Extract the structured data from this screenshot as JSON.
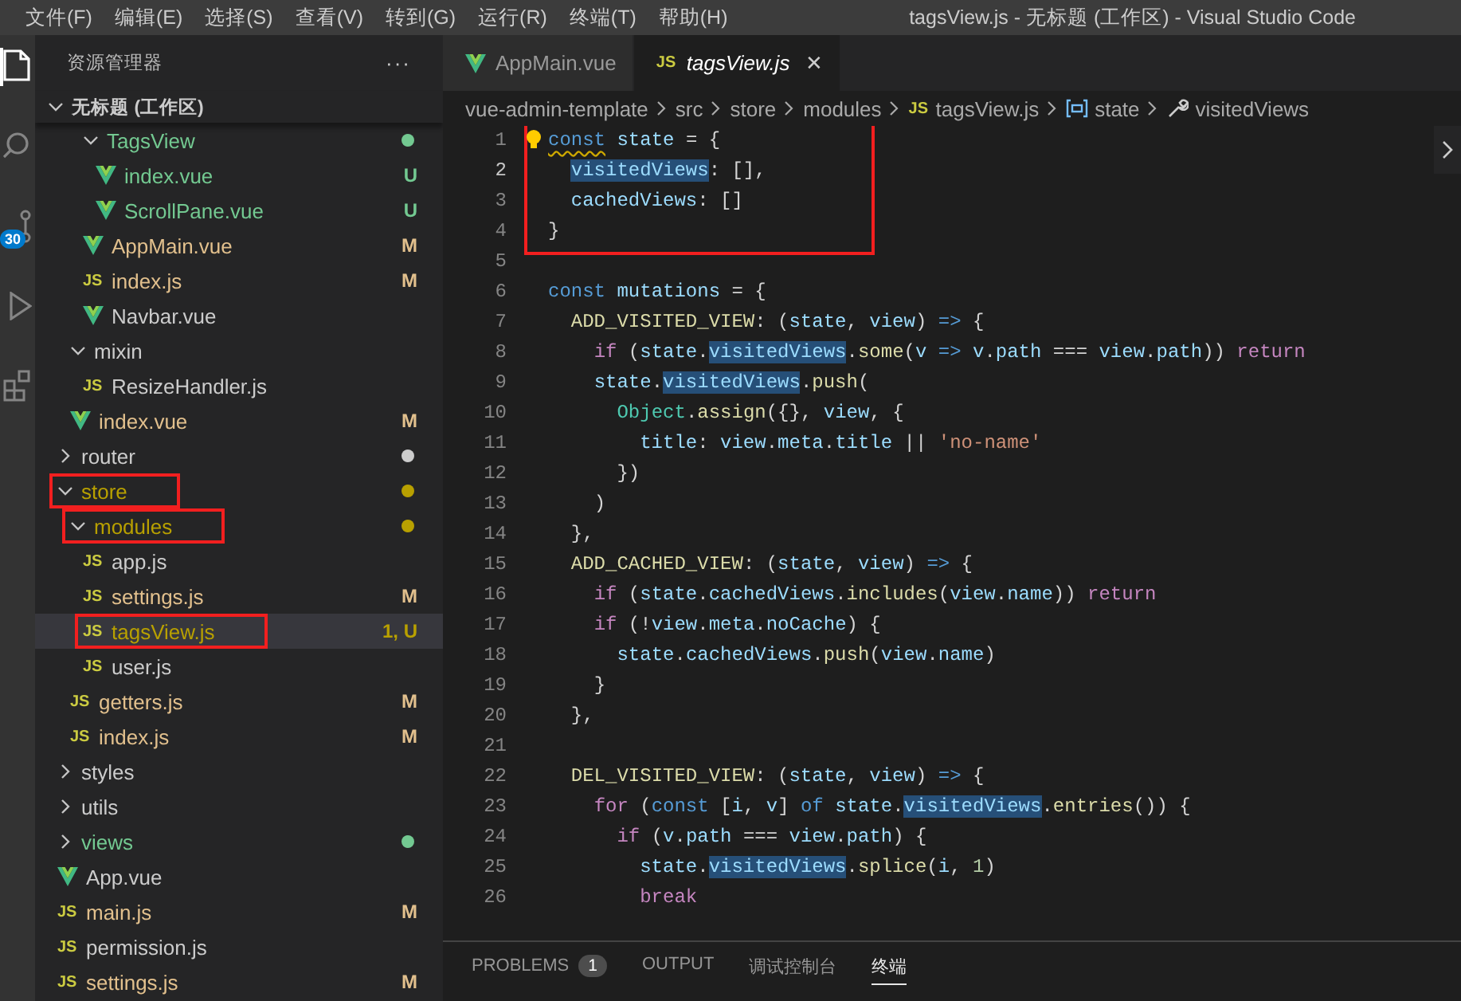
{
  "window": {
    "title": "tagsView.js - 无标题 (工作区) - Visual Studio Code"
  },
  "menu": [
    "文件(F)",
    "编辑(E)",
    "选择(S)",
    "查看(V)",
    "转到(G)",
    "运行(R)",
    "终端(T)",
    "帮助(H)"
  ],
  "activity_bar": [
    {
      "kind": "files",
      "selected": true
    },
    {
      "kind": "search",
      "selected": false
    },
    {
      "kind": "source-control",
      "selected": false,
      "badge": "30"
    },
    {
      "kind": "run",
      "selected": false
    },
    {
      "kind": "extensions",
      "selected": false
    }
  ],
  "sidebar": {
    "title": "资源管理器",
    "more": "···",
    "workspace": {
      "label": "无标题 (工作区)",
      "expanded": true
    },
    "items": [
      {
        "children": [
          {
            "children": [
              {
                "label": "TagsView",
                "kind": "folder",
                "expanded": true,
                "selected": false,
                "color": "#73c991",
                "dot": true,
                "children": [
                  {
                    "label": "index.vue",
                    "kind": "vue",
                    "selected": false,
                    "color": "#73c991",
                    "badge": "U"
                  },
                  {
                    "label": "ScrollPane.vue",
                    "kind": "vue",
                    "selected": false,
                    "color": "#73c991",
                    "badge": "U"
                  }
                ]
              },
              {
                "label": "AppMain.vue",
                "kind": "vue",
                "selected": false,
                "color": "#e2c08d",
                "badge": "M"
              },
              {
                "label": "index.js",
                "kind": "js",
                "icon_label": "JS",
                "selected": false,
                "color": "#e2c08d",
                "badge": "M"
              },
              {
                "label": "Navbar.vue",
                "kind": "vue",
                "selected": false,
                "color": "#cccccc"
              }
            ]
          },
          {
            "label": "mixin",
            "kind": "folder",
            "expanded": true,
            "selected": false,
            "color": "#cccccc",
            "children": [
              {
                "label": "ResizeHandler.js",
                "kind": "js",
                "icon_label": "JS",
                "selected": false,
                "color": "#cccccc"
              }
            ]
          },
          {
            "label": "index.vue",
            "kind": "vue",
            "selected": false,
            "color": "#e2c08d",
            "badge": "M"
          }
        ]
      },
      {
        "label": "router",
        "kind": "folder",
        "expanded": false,
        "selected": false,
        "color": "#cccccc",
        "dot": true
      },
      {
        "label": "store",
        "kind": "folder",
        "expanded": true,
        "selected": false,
        "color": "#b8a000",
        "dot": true,
        "annotated": true,
        "children": [
          {
            "label": "modules",
            "kind": "folder",
            "expanded": true,
            "selected": false,
            "color": "#b8a000",
            "dot": true,
            "annotated": true,
            "children": [
              {
                "label": "app.js",
                "kind": "js",
                "icon_label": "JS",
                "selected": false,
                "color": "#cccccc"
              },
              {
                "label": "settings.js",
                "kind": "js",
                "icon_label": "JS",
                "selected": false,
                "color": "#e2c08d",
                "badge": "M"
              },
              {
                "label": "tagsView.js",
                "kind": "js",
                "icon_label": "JS",
                "color": "#b8a000",
                "badge": "1, U",
                "selected": true,
                "annotated": true
              },
              {
                "label": "user.js",
                "kind": "js",
                "icon_label": "JS",
                "selected": false,
                "color": "#cccccc"
              }
            ]
          },
          {
            "label": "getters.js",
            "kind": "js",
            "icon_label": "JS",
            "selected": false,
            "color": "#e2c08d",
            "badge": "M"
          },
          {
            "label": "index.js",
            "kind": "js",
            "icon_label": "JS",
            "selected": false,
            "color": "#e2c08d",
            "badge": "M"
          }
        ]
      },
      {
        "label": "styles",
        "kind": "folder",
        "expanded": false,
        "selected": false,
        "color": "#cccccc"
      },
      {
        "label": "utils",
        "kind": "folder",
        "expanded": false,
        "selected": false,
        "color": "#cccccc"
      },
      {
        "label": "views",
        "kind": "folder",
        "expanded": false,
        "selected": false,
        "color": "#73c991",
        "dot": true
      },
      {
        "label": "App.vue",
        "kind": "vue",
        "selected": false,
        "color": "#cccccc"
      },
      {
        "label": "main.js",
        "kind": "js",
        "icon_label": "JS",
        "selected": false,
        "color": "#e2c08d",
        "badge": "M"
      },
      {
        "label": "permission.js",
        "kind": "js",
        "icon_label": "JS",
        "selected": false,
        "color": "#cccccc"
      },
      {
        "label": "settings.js",
        "kind": "js",
        "icon_label": "JS",
        "selected": false,
        "color": "#e2c08d",
        "badge": "M"
      }
    ]
  },
  "tabs": [
    {
      "label": "AppMain.vue",
      "kind": "vue",
      "selected": false,
      "preview": false
    },
    {
      "label": "tagsView.js",
      "kind": "js",
      "icon_label": "JS",
      "selected": true,
      "preview": true,
      "close": "✕"
    }
  ],
  "breadcrumb": [
    {
      "label": "vue-admin-template"
    },
    {
      "label": "src"
    },
    {
      "label": "store"
    },
    {
      "label": "modules"
    },
    {
      "label": "tagsView.js",
      "kind": "js",
      "icon_label": "JS"
    },
    {
      "label": "state",
      "kind": "variable"
    },
    {
      "label": "visitedViews",
      "kind": "property"
    }
  ],
  "code": [
    {
      "number": "1",
      "annotated": true,
      "lightbulb": true,
      "tokens": [
        {
          "text": "const",
          "kind": "keyword",
          "warning": true
        },
        {
          "text": " state",
          "kind": "variable"
        },
        {
          "text": " = {"
        }
      ]
    },
    {
      "number": "2",
      "annotated": true,
      "current": true,
      "tokens": [
        {
          "text": "  visitedViews",
          "kind": "variable",
          "highlight": true
        },
        {
          "text": ": [],"
        }
      ]
    },
    {
      "number": "3",
      "annotated": true,
      "tokens": [
        {
          "text": "  cachedViews",
          "kind": "variable"
        },
        {
          "text": ": []"
        }
      ]
    },
    {
      "number": "4",
      "annotated": true,
      "tokens": [
        {
          "text": "}"
        }
      ]
    },
    {
      "number": "5"
    },
    {
      "number": "6",
      "tokens": [
        {
          "text": "const",
          "kind": "keyword"
        },
        {
          "text": " mutations",
          "kind": "variable"
        },
        {
          "text": " = {"
        }
      ]
    },
    {
      "number": "7",
      "tokens": [
        {
          "text": "  ADD_VISITED_VIEW",
          "kind": "function"
        },
        {
          "text": ": ("
        },
        {
          "text": "state",
          "kind": "variable"
        },
        {
          "text": ", "
        },
        {
          "text": "view",
          "kind": "variable"
        },
        {
          "text": ") "
        },
        {
          "text": "=>",
          "kind": "keyword"
        },
        {
          "text": " {"
        }
      ]
    },
    {
      "number": "8",
      "tokens": [
        {
          "text": "    if",
          "kind": "control"
        },
        {
          "text": " ("
        },
        {
          "text": "state",
          "kind": "variable"
        },
        {
          "text": "."
        },
        {
          "text": "visitedViews",
          "kind": "variable",
          "highlight": true
        },
        {
          "text": "."
        },
        {
          "text": "some",
          "kind": "function"
        },
        {
          "text": "("
        },
        {
          "text": "v",
          "kind": "variable"
        },
        {
          "text": " =>",
          "kind": "keyword"
        },
        {
          "text": " v",
          "kind": "variable"
        },
        {
          "text": "."
        },
        {
          "text": "path",
          "kind": "variable"
        },
        {
          "text": " === "
        },
        {
          "text": "view",
          "kind": "variable"
        },
        {
          "text": "."
        },
        {
          "text": "path",
          "kind": "variable"
        },
        {
          "text": ")) "
        },
        {
          "text": "return",
          "kind": "control"
        }
      ]
    },
    {
      "number": "9",
      "tokens": [
        {
          "text": "    state",
          "kind": "variable"
        },
        {
          "text": "."
        },
        {
          "text": "visitedViews",
          "kind": "variable",
          "highlight": true
        },
        {
          "text": "."
        },
        {
          "text": "push",
          "kind": "function"
        },
        {
          "text": "("
        }
      ]
    },
    {
      "number": "10",
      "tokens": [
        {
          "text": "      Object",
          "kind": "class"
        },
        {
          "text": "."
        },
        {
          "text": "assign",
          "kind": "function"
        },
        {
          "text": "({}, "
        },
        {
          "text": "view",
          "kind": "variable"
        },
        {
          "text": ", {"
        }
      ]
    },
    {
      "number": "11",
      "tokens": [
        {
          "text": "        title",
          "kind": "variable"
        },
        {
          "text": ": "
        },
        {
          "text": "view",
          "kind": "variable"
        },
        {
          "text": "."
        },
        {
          "text": "meta",
          "kind": "variable"
        },
        {
          "text": "."
        },
        {
          "text": "title",
          "kind": "variable"
        },
        {
          "text": " || "
        },
        {
          "text": "'no-name'",
          "kind": "string"
        }
      ]
    },
    {
      "number": "12",
      "tokens": [
        {
          "text": "      })"
        }
      ]
    },
    {
      "number": "13",
      "tokens": [
        {
          "text": "    )"
        }
      ]
    },
    {
      "number": "14",
      "tokens": [
        {
          "text": "  },"
        }
      ]
    },
    {
      "number": "15",
      "tokens": [
        {
          "text": "  ADD_CACHED_VIEW",
          "kind": "function"
        },
        {
          "text": ": ("
        },
        {
          "text": "state",
          "kind": "variable"
        },
        {
          "text": ", "
        },
        {
          "text": "view",
          "kind": "variable"
        },
        {
          "text": ") "
        },
        {
          "text": "=>",
          "kind": "keyword"
        },
        {
          "text": " {"
        }
      ]
    },
    {
      "number": "16",
      "tokens": [
        {
          "text": "    if",
          "kind": "control"
        },
        {
          "text": " ("
        },
        {
          "text": "state",
          "kind": "variable"
        },
        {
          "text": "."
        },
        {
          "text": "cachedViews",
          "kind": "variable"
        },
        {
          "text": "."
        },
        {
          "text": "includes",
          "kind": "function"
        },
        {
          "text": "("
        },
        {
          "text": "view",
          "kind": "variable"
        },
        {
          "text": "."
        },
        {
          "text": "name",
          "kind": "variable"
        },
        {
          "text": ")) "
        },
        {
          "text": "return",
          "kind": "control"
        }
      ]
    },
    {
      "number": "17",
      "tokens": [
        {
          "text": "    if",
          "kind": "control"
        },
        {
          "text": " (!"
        },
        {
          "text": "view",
          "kind": "variable"
        },
        {
          "text": "."
        },
        {
          "text": "meta",
          "kind": "variable"
        },
        {
          "text": "."
        },
        {
          "text": "noCache",
          "kind": "variable"
        },
        {
          "text": ") {"
        }
      ]
    },
    {
      "number": "18",
      "tokens": [
        {
          "text": "      state",
          "kind": "variable"
        },
        {
          "text": "."
        },
        {
          "text": "cachedViews",
          "kind": "variable"
        },
        {
          "text": "."
        },
        {
          "text": "push",
          "kind": "function"
        },
        {
          "text": "("
        },
        {
          "text": "view",
          "kind": "variable"
        },
        {
          "text": "."
        },
        {
          "text": "name",
          "kind": "variable"
        },
        {
          "text": ")"
        }
      ]
    },
    {
      "number": "19",
      "tokens": [
        {
          "text": "    }"
        }
      ]
    },
    {
      "number": "20",
      "tokens": [
        {
          "text": "  },"
        }
      ]
    },
    {
      "number": "21"
    },
    {
      "number": "22",
      "tokens": [
        {
          "text": "  DEL_VISITED_VIEW",
          "kind": "function"
        },
        {
          "text": ": ("
        },
        {
          "text": "state",
          "kind": "variable"
        },
        {
          "text": ", "
        },
        {
          "text": "view",
          "kind": "variable"
        },
        {
          "text": ") "
        },
        {
          "text": "=>",
          "kind": "keyword"
        },
        {
          "text": " {"
        }
      ]
    },
    {
      "number": "23",
      "tokens": [
        {
          "text": "    for",
          "kind": "control"
        },
        {
          "text": " ("
        },
        {
          "text": "const",
          "kind": "keyword"
        },
        {
          "text": " ["
        },
        {
          "text": "i",
          "kind": "variable"
        },
        {
          "text": ", "
        },
        {
          "text": "v",
          "kind": "variable"
        },
        {
          "text": "] "
        },
        {
          "text": "of",
          "kind": "keyword"
        },
        {
          "text": " state",
          "kind": "variable"
        },
        {
          "text": "."
        },
        {
          "text": "visitedViews",
          "kind": "variable",
          "highlight": true
        },
        {
          "text": "."
        },
        {
          "text": "entries",
          "kind": "function"
        },
        {
          "text": "()) {"
        }
      ]
    },
    {
      "number": "24",
      "tokens": [
        {
          "text": "      if",
          "kind": "control"
        },
        {
          "text": " ("
        },
        {
          "text": "v",
          "kind": "variable"
        },
        {
          "text": "."
        },
        {
          "text": "path",
          "kind": "variable"
        },
        {
          "text": " === "
        },
        {
          "text": "view",
          "kind": "variable"
        },
        {
          "text": "."
        },
        {
          "text": "path",
          "kind": "variable"
        },
        {
          "text": ") {"
        }
      ]
    },
    {
      "number": "25",
      "tokens": [
        {
          "text": "        state",
          "kind": "variable"
        },
        {
          "text": "."
        },
        {
          "text": "visitedViews",
          "kind": "variable",
          "highlight": true
        },
        {
          "text": "."
        },
        {
          "text": "splice",
          "kind": "function"
        },
        {
          "text": "("
        },
        {
          "text": "i",
          "kind": "variable"
        },
        {
          "text": ", "
        },
        {
          "text": "1",
          "kind": "number"
        },
        {
          "text": ")"
        }
      ]
    },
    {
      "number": "26",
      "tokens": [
        {
          "text": "        break",
          "kind": "control"
        }
      ]
    }
  ],
  "panel": {
    "tabs": [
      {
        "label": "PROBLEMS",
        "count": "1",
        "selected": false
      },
      {
        "label": "OUTPUT",
        "selected": false
      },
      {
        "label": "调试控制台",
        "selected": false
      },
      {
        "label": "终端",
        "selected": true
      }
    ]
  }
}
